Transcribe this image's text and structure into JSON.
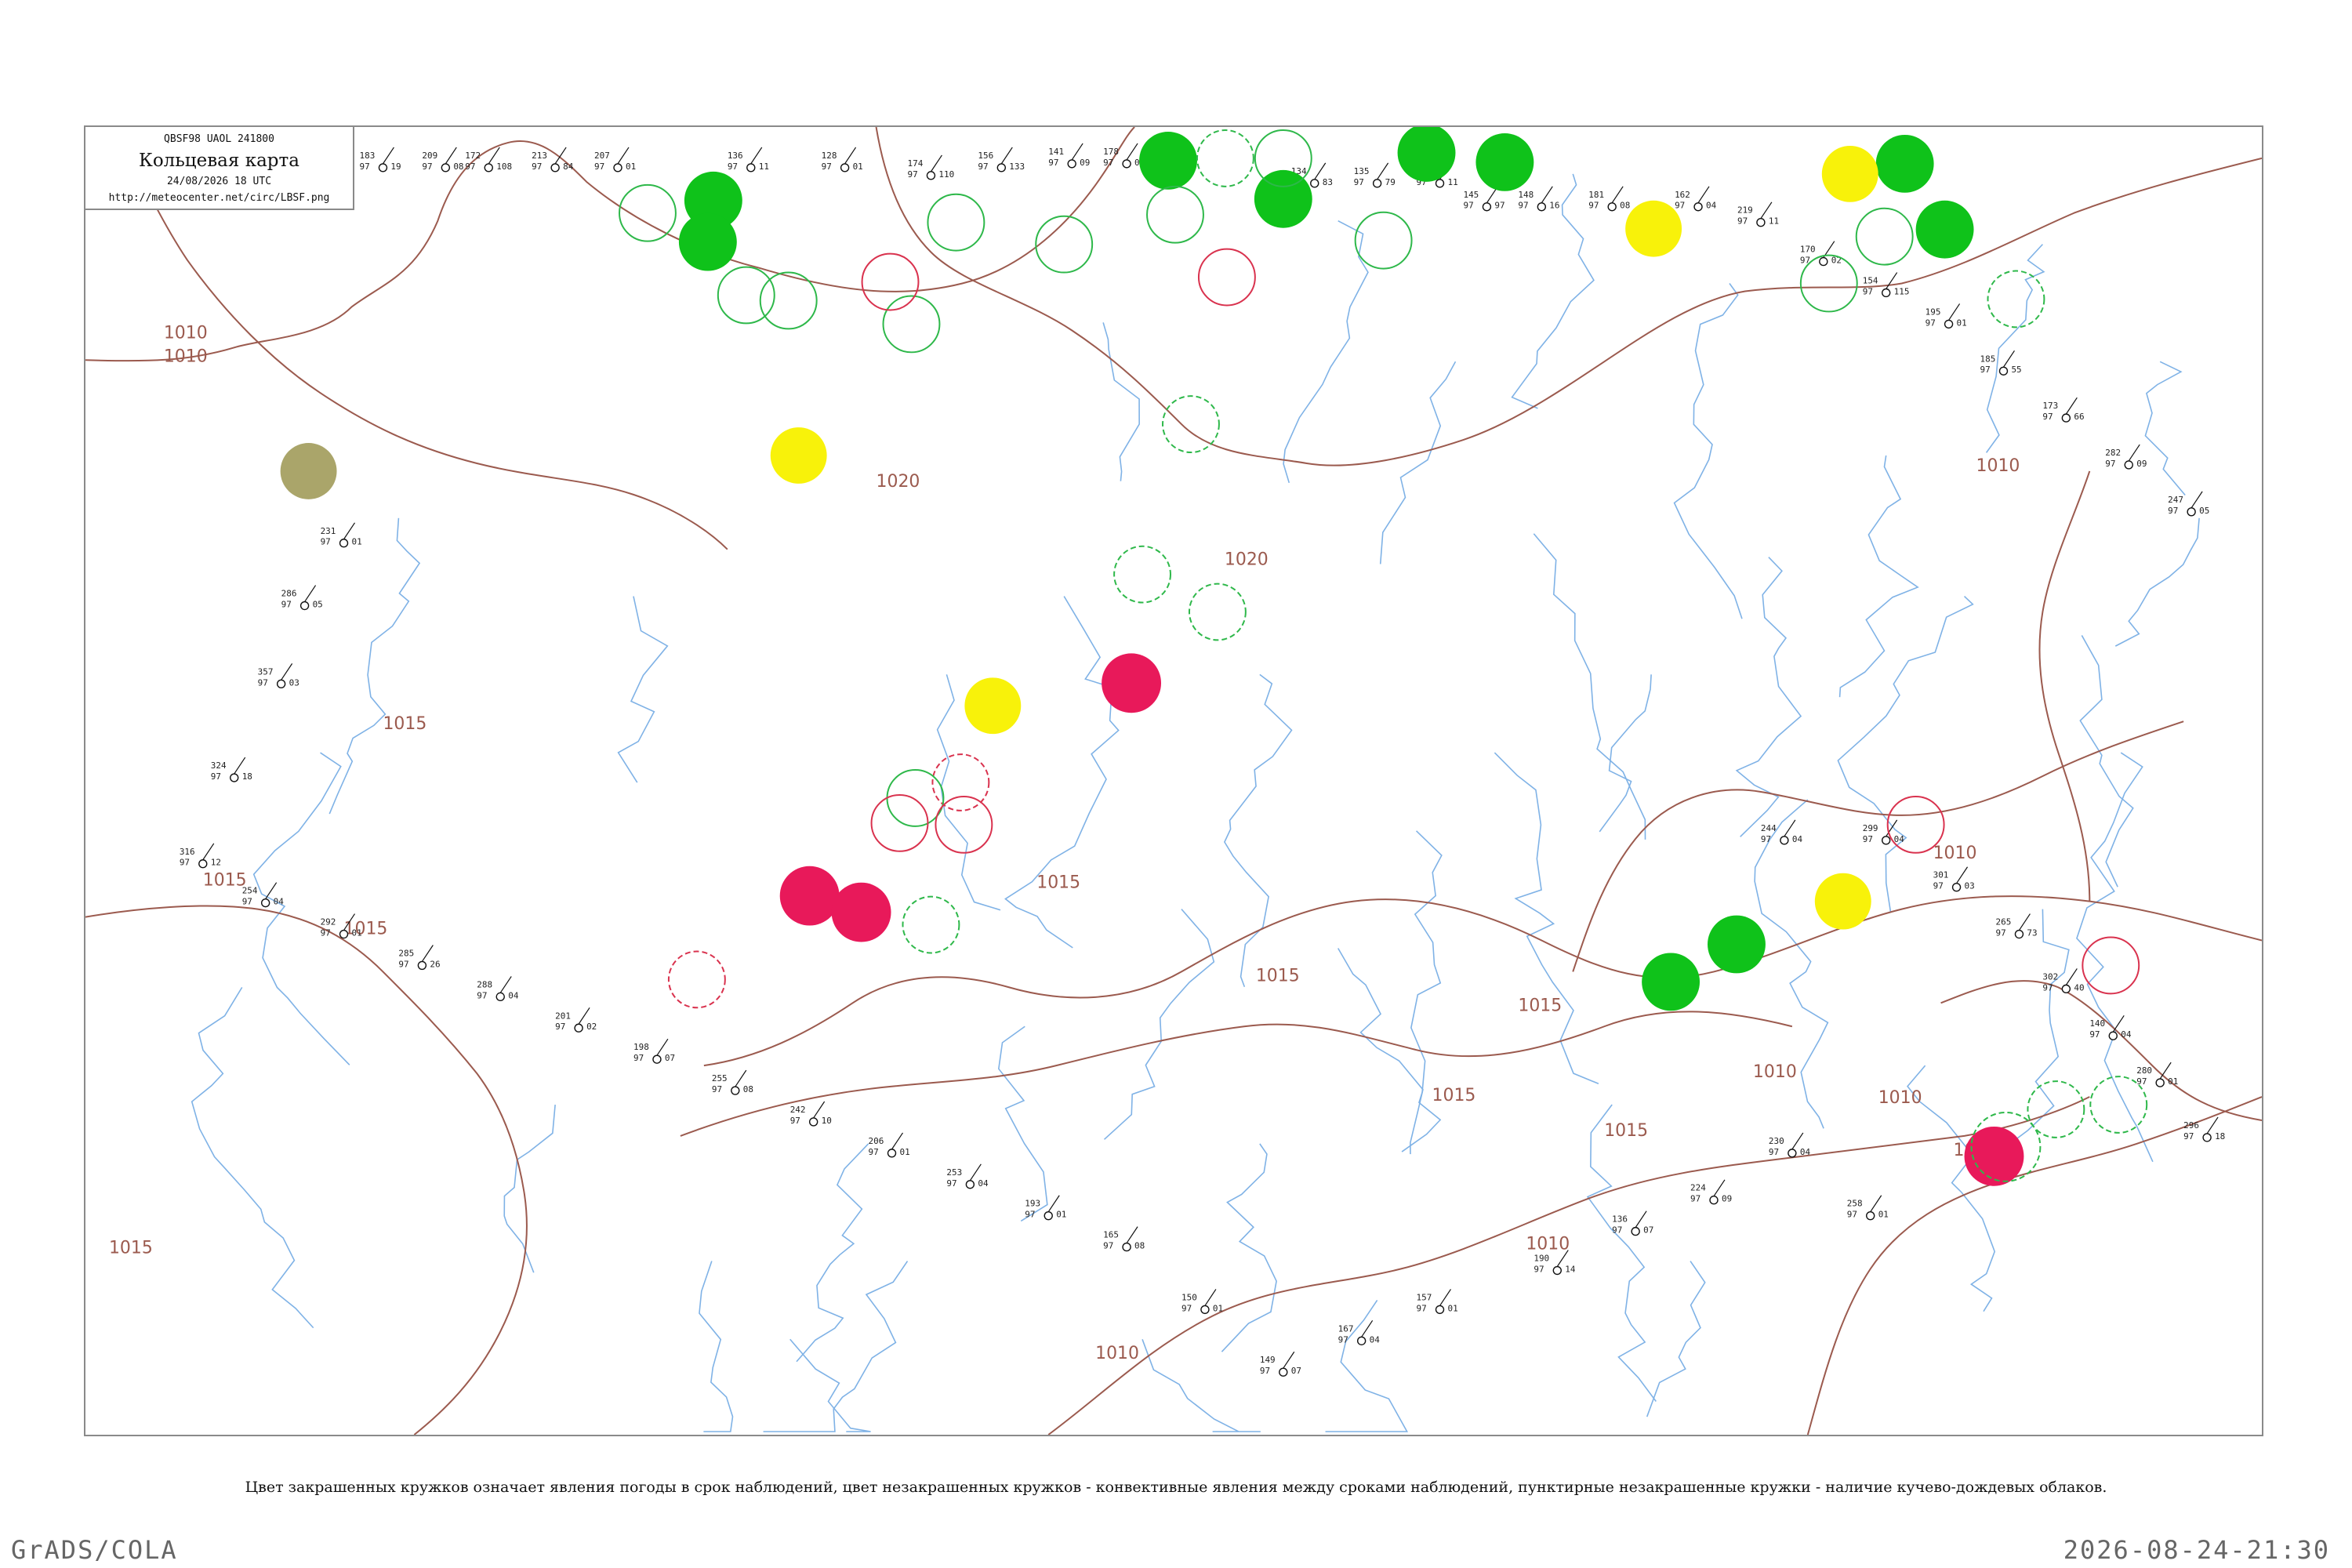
{
  "header": {
    "code": "QBSF98  UAOL  241800",
    "title": "Кольцевая карта",
    "date": "24/08/2026 18 UTC",
    "url": "http://meteocenter.net/circ/LBSF.png"
  },
  "footnote": "Цвет закрашенных кружков означает явления погоды в срок наблюдений, цвет незакрашенных кружков - конвективные явления между сроками наблюдений, пунктирные незакрашенные кружки - наличие кучево-дождевых облаков.",
  "footer": {
    "left": "GrADS/COLA",
    "right": "2026-08-24-21:30"
  },
  "colors": {
    "isobar": "#9b5a4e",
    "river": "#7fb2e6",
    "green_fill": "#0fc21a",
    "red_fill": "#e8195a",
    "yellow_fill": "#f8f20a",
    "olive_fill": "#aaa56a",
    "green_ring": "#2eb84a",
    "red_ring": "#d9324e"
  },
  "isobar_labels": [
    "1010",
    "1010",
    "1015",
    "1015",
    "1015",
    "1020",
    "1020",
    "1015",
    "1015",
    "1015",
    "1015",
    "1010",
    "1010",
    "1015",
    "1010",
    "1005",
    "1010",
    "1010",
    "1010",
    "1015"
  ],
  "stations": [
    {
      "a": "183",
      "b": "97",
      "c": "19"
    },
    {
      "a": "209",
      "b": "97",
      "c": "08"
    },
    {
      "a": "172",
      "b": "97",
      "c": "108"
    },
    {
      "a": "213",
      "b": "97",
      "c": "84"
    },
    {
      "a": "207",
      "b": "97",
      "c": "01"
    },
    {
      "a": "136",
      "b": "97",
      "c": "11"
    },
    {
      "a": "128",
      "b": "97",
      "c": "01"
    },
    {
      "a": "174",
      "b": "97",
      "c": "110"
    },
    {
      "a": "156",
      "b": "97",
      "c": "133"
    },
    {
      "a": "141",
      "b": "97",
      "c": "09"
    },
    {
      "a": "178",
      "b": "97",
      "c": "03"
    },
    {
      "a": "134",
      "b": "97",
      "c": "83"
    },
    {
      "a": "135",
      "b": "97",
      "c": "79"
    },
    {
      "a": "126",
      "b": "97",
      "c": "11"
    },
    {
      "a": "145",
      "b": "97",
      "c": "97"
    },
    {
      "a": "148",
      "b": "97",
      "c": "16"
    },
    {
      "a": "181",
      "b": "97",
      "c": "08"
    },
    {
      "a": "162",
      "b": "97",
      "c": "04"
    },
    {
      "a": "219",
      "b": "97",
      "c": "11"
    },
    {
      "a": "170",
      "b": "97",
      "c": "02"
    },
    {
      "a": "154",
      "b": "97",
      "c": "115"
    },
    {
      "a": "195",
      "b": "97",
      "c": "01"
    },
    {
      "a": "185",
      "b": "97",
      "c": "55"
    },
    {
      "a": "173",
      "b": "97",
      "c": "66"
    },
    {
      "a": "282",
      "b": "97",
      "c": "09"
    },
    {
      "a": "247",
      "b": "97",
      "c": "05"
    },
    {
      "a": "244",
      "b": "97",
      "c": "04"
    },
    {
      "a": "299",
      "b": "97",
      "c": "04"
    },
    {
      "a": "301",
      "b": "97",
      "c": "03"
    },
    {
      "a": "265",
      "b": "97",
      "c": "73"
    },
    {
      "a": "302",
      "b": "97",
      "c": "40"
    },
    {
      "a": "140",
      "b": "97",
      "c": "04"
    },
    {
      "a": "280",
      "b": "97",
      "c": "01"
    },
    {
      "a": "296",
      "b": "97",
      "c": "18"
    },
    {
      "a": "258",
      "b": "97",
      "c": "01"
    },
    {
      "a": "230",
      "b": "97",
      "c": "04"
    },
    {
      "a": "224",
      "b": "97",
      "c": "09"
    },
    {
      "a": "136",
      "b": "97",
      "c": "07"
    },
    {
      "a": "190",
      "b": "97",
      "c": "14"
    },
    {
      "a": "157",
      "b": "97",
      "c": "01"
    },
    {
      "a": "167",
      "b": "97",
      "c": "04"
    },
    {
      "a": "149",
      "b": "97",
      "c": "07"
    },
    {
      "a": "150",
      "b": "97",
      "c": "01"
    },
    {
      "a": "165",
      "b": "97",
      "c": "08"
    },
    {
      "a": "193",
      "b": "97",
      "c": "01"
    },
    {
      "a": "253",
      "b": "97",
      "c": "04"
    },
    {
      "a": "206",
      "b": "97",
      "c": "01"
    },
    {
      "a": "242",
      "b": "97",
      "c": "10"
    },
    {
      "a": "255",
      "b": "97",
      "c": "08"
    },
    {
      "a": "198",
      "b": "97",
      "c": "07"
    },
    {
      "a": "201",
      "b": "97",
      "c": "02"
    },
    {
      "a": "288",
      "b": "97",
      "c": "04"
    },
    {
      "a": "285",
      "b": "97",
      "c": "26"
    },
    {
      "a": "292",
      "b": "97",
      "c": "01"
    },
    {
      "a": "254",
      "b": "97",
      "c": "04"
    },
    {
      "a": "316",
      "b": "97",
      "c": "12"
    },
    {
      "a": "324",
      "b": "97",
      "c": "18"
    },
    {
      "a": "357",
      "b": "97",
      "c": "03"
    },
    {
      "a": "286",
      "b": "97",
      "c": "05"
    },
    {
      "a": "231",
      "b": "97",
      "c": "01"
    }
  ]
}
